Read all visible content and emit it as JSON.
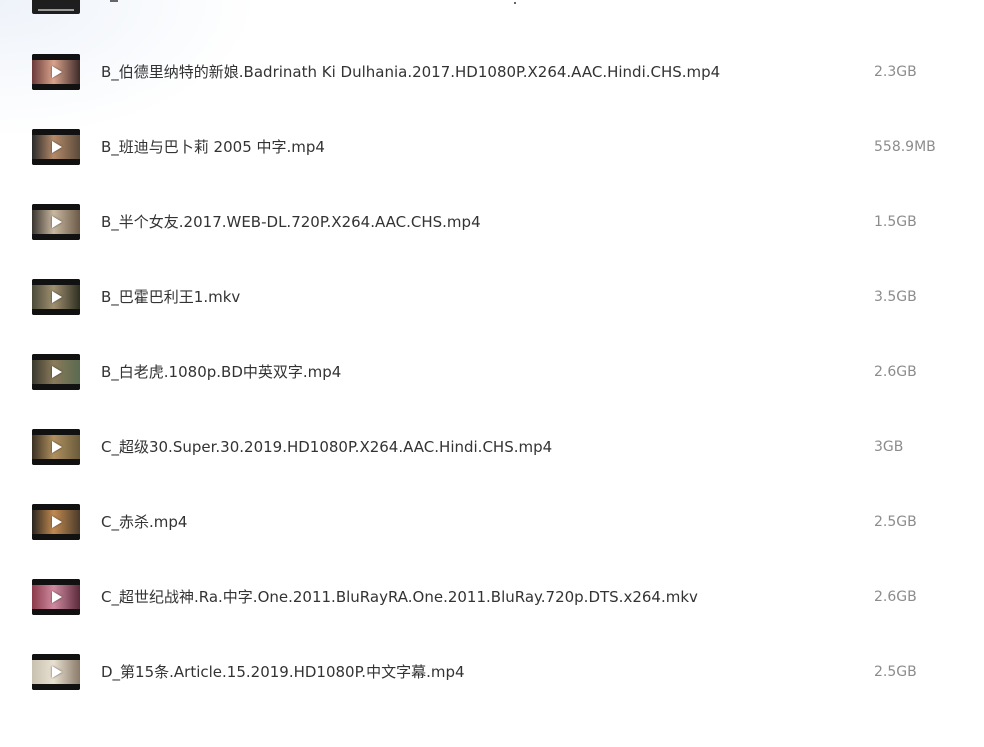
{
  "files": [
    {
      "name": "B_伯德里纳特的新娘.Badrinath Ki Dulhania.2017.HD1080P.X264.AAC.Hindi.CHS.mp4",
      "size": "2.3GB",
      "thumb_colors": [
        "#6b3a3a",
        "#d9a38a",
        "#3d2a2a"
      ]
    },
    {
      "name": "B_班迪与巴卜莉 2005 中字.mp4",
      "size": "558.9MB",
      "thumb_colors": [
        "#2a2a2a",
        "#b48a6a",
        "#5a4a3a"
      ]
    },
    {
      "name": "B_半个女友.2017.WEB-DL.720P.X264.AAC.CHS.mp4",
      "size": "1.5GB",
      "thumb_colors": [
        "#3a3530",
        "#c9b8a0",
        "#6a5a48"
      ]
    },
    {
      "name": "B_巴霍巴利王1.mkv",
      "size": "3.5GB",
      "thumb_colors": [
        "#4a4a3a",
        "#a09070",
        "#2e2e22"
      ]
    },
    {
      "name": "B_白老虎.1080p.BD中英双字.mp4",
      "size": "2.6GB",
      "thumb_colors": [
        "#3a3a30",
        "#8a7a5a",
        "#5a6a50"
      ]
    },
    {
      "name": "C_超级30.Super.30.2019.HD1080P.X264.AAC.Hindi.CHS.mp4",
      "size": "3GB",
      "thumb_colors": [
        "#3a3022",
        "#b09060",
        "#6a5a3a"
      ]
    },
    {
      "name": "C_赤杀.mp4",
      "size": "2.5GB",
      "thumb_colors": [
        "#2a2520",
        "#c08a50",
        "#4a3a2a"
      ]
    },
    {
      "name": "C_超世纪战神.Ra.中字.One.2011.BluRayRA.One.2011.BluRay.720p.DTS.x264.mkv",
      "size": "2.6GB",
      "thumb_colors": [
        "#8a3a4a",
        "#d08aa0",
        "#5a2a3a"
      ]
    },
    {
      "name": "D_第15条.Article.15.2019.HD1080P.中文字幕.mp4",
      "size": "2.5GB",
      "thumb_colors": [
        "#c8c0b0",
        "#e8e0d0",
        "#8a7a6a"
      ]
    }
  ]
}
